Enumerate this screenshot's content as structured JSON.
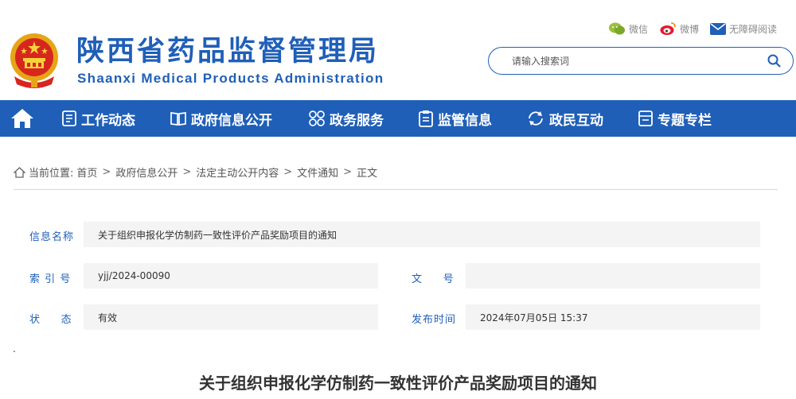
{
  "header": {
    "site_title": "陕西省药品监督管理局",
    "site_subtitle": "Shaanxi Medical Products Administration",
    "top_links": {
      "wechat": "微信",
      "weibo": "微博",
      "accessibility": "无障碍阅读"
    },
    "search_placeholder": "请输入搜索词"
  },
  "nav": {
    "items": [
      {
        "label": "工作动态",
        "icon": "document-list-icon"
      },
      {
        "label": "政府信息公开",
        "icon": "book-icon"
      },
      {
        "label": "政务服务",
        "icon": "grid-circles-icon"
      },
      {
        "label": "监管信息",
        "icon": "clipboard-icon"
      },
      {
        "label": "政民互动",
        "icon": "interaction-icon"
      },
      {
        "label": "专题专栏",
        "icon": "folder-icon"
      }
    ]
  },
  "breadcrumb": {
    "prefix": "当前位置:",
    "items": [
      "首页",
      "政府信息公开",
      "法定主动公开内容",
      "文件通知",
      "正文"
    ]
  },
  "info": {
    "name_label": "信息名称",
    "name_value": "关于组织申报化学仿制药一致性评价产品奖励项目的通知",
    "index_label": "索 引 号",
    "index_value": "yjj/2024-00090",
    "doc_label": "文     号",
    "doc_value": "",
    "status_label": "状     态",
    "status_value": "有效",
    "date_label": "发布时间",
    "date_value": "2024年07月05日 15:37"
  },
  "article": {
    "dot": ".",
    "title": "关于组织申报化学仿制药一致性评价产品奖励项目的通知"
  },
  "colors": {
    "brand": "#1f5fb8",
    "field_bg": "#f4f4f4"
  }
}
